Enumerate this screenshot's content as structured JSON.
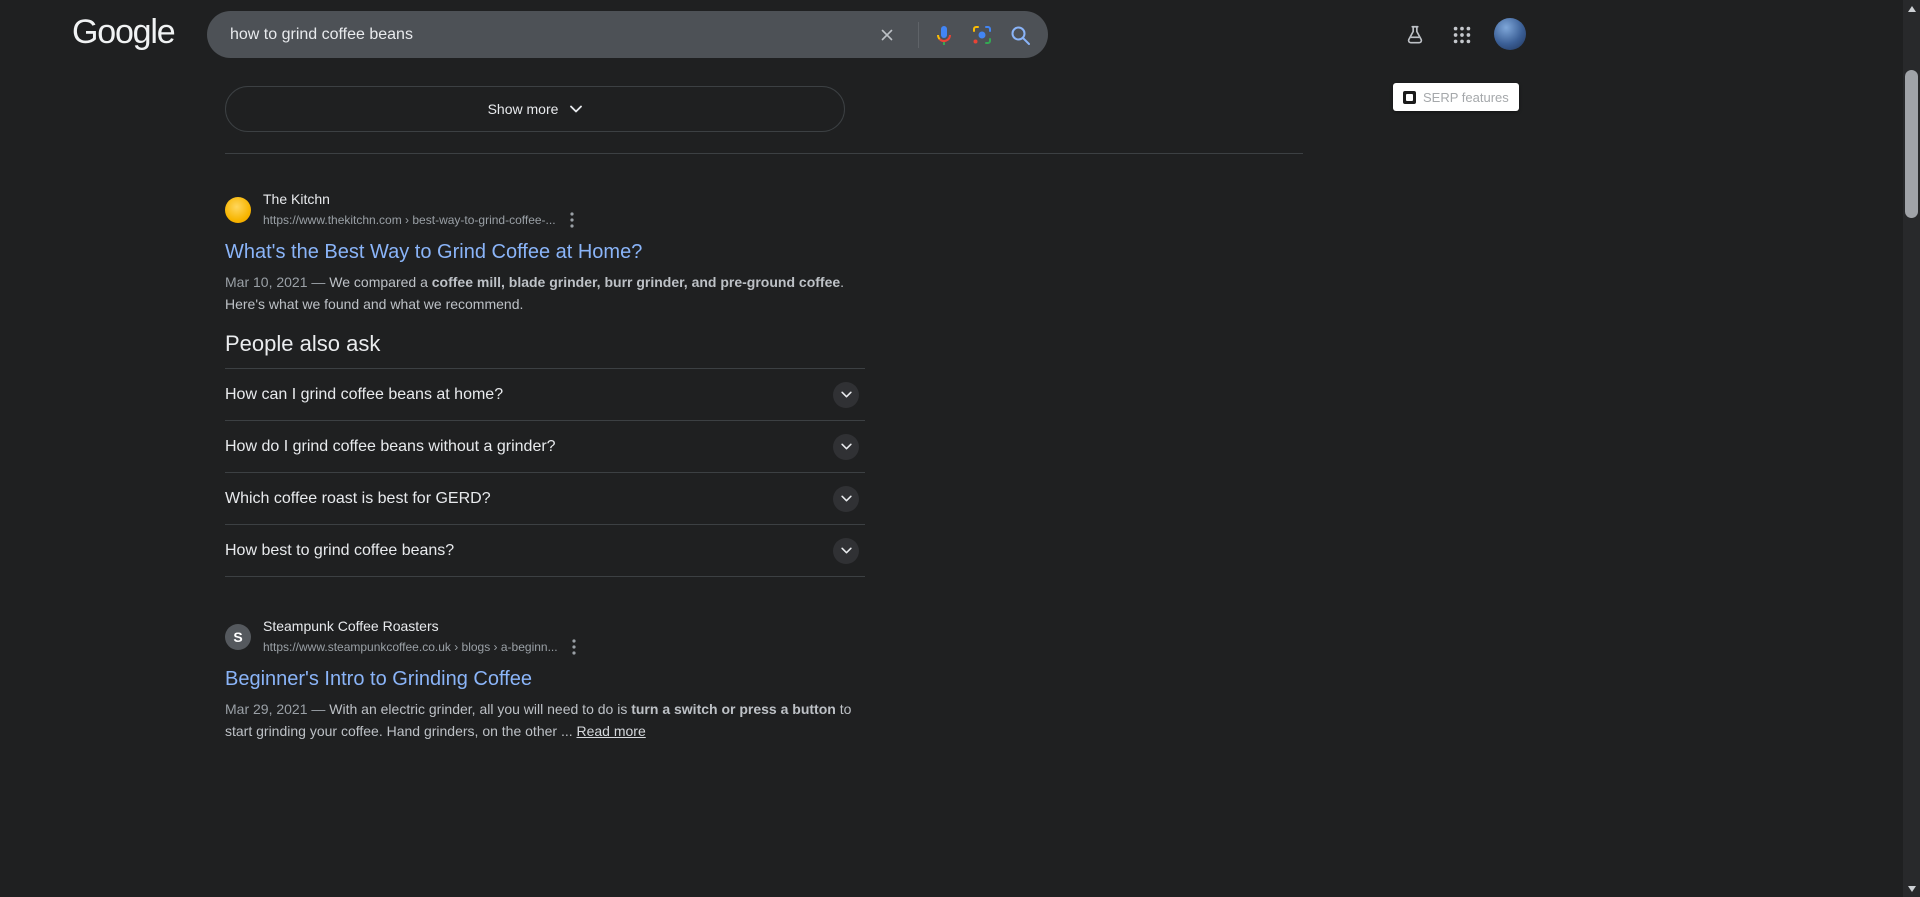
{
  "header": {
    "logo_text": "Google",
    "search_query": "how to grind coffee beans"
  },
  "extension_badge": {
    "label": "SERP features"
  },
  "buttons": {
    "show_more": "Show more"
  },
  "results": [
    {
      "site": "The Kitchn",
      "breadcrumb": "https://www.thekitchn.com › best-way-to-grind-coffee-...",
      "title": "What's the Best Way to Grind Coffee at Home?",
      "snippet_parts": [
        {
          "text": "Mar 10, 2021 — ",
          "muted": true
        },
        {
          "text": "We compared a "
        },
        {
          "text": "coffee mill, blade grinder, burr grinder, and pre-ground coffee",
          "bold": true
        },
        {
          "text": ". Here's what we found and what we recommend."
        }
      ]
    },
    {
      "site": "Steampunk Coffee Roasters",
      "breadcrumb": "https://www.steampunkcoffee.co.uk › blogs › a-beginn...",
      "title": "Beginner's Intro to Grinding Coffee",
      "favicon_letter": "S",
      "snippet_parts": [
        {
          "text": "Mar 29, 2021 — ",
          "muted": true
        },
        {
          "text": "With an electric grinder, all you will need to do is "
        },
        {
          "text": "turn a switch or press a button",
          "bold": true
        },
        {
          "text": " to start grinding your coffee. Hand grinders, on the other ... "
        },
        {
          "text": "Read more",
          "link": true
        }
      ]
    }
  ],
  "people_also_ask": {
    "heading": "People also ask",
    "questions": [
      "How can I grind coffee beans at home?",
      "How do I grind coffee beans without a grinder?",
      "Which coffee roast is best for GERD?",
      "How best to grind coffee beans?"
    ]
  },
  "icons": {
    "clear": "close-x",
    "voice": "google-mic",
    "lens": "google-lens",
    "search": "magnifier",
    "labs": "flask",
    "apps": "grid-3x3",
    "result_menu": "kebab-vertical",
    "expand": "chevron-down"
  },
  "colors": {
    "background": "#1f2021",
    "search_box": "#4d5156",
    "link_blue": "#8ab4f8",
    "text_primary": "#e8eaed",
    "text_snippet": "#bdc1c6",
    "text_muted": "#9aa0a6",
    "divider": "#3c4043",
    "kitchn_favicon": "#f7b500"
  }
}
